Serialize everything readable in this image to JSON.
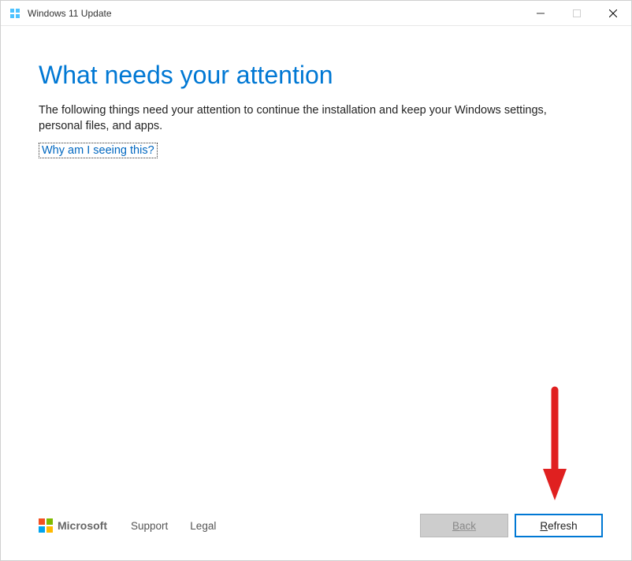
{
  "titlebar": {
    "title": "Windows 11 Update"
  },
  "content": {
    "heading": "What needs your attention",
    "description": "The following things need your attention to continue the installation and keep your Windows settings, personal files, and apps.",
    "why_link": "Why am I seeing this?"
  },
  "footer": {
    "logo_text": "Microsoft",
    "support_link": "Support",
    "legal_link": "Legal",
    "back_prefix": "B",
    "back_rest": "ack",
    "refresh_prefix": "R",
    "refresh_rest": "efresh"
  }
}
